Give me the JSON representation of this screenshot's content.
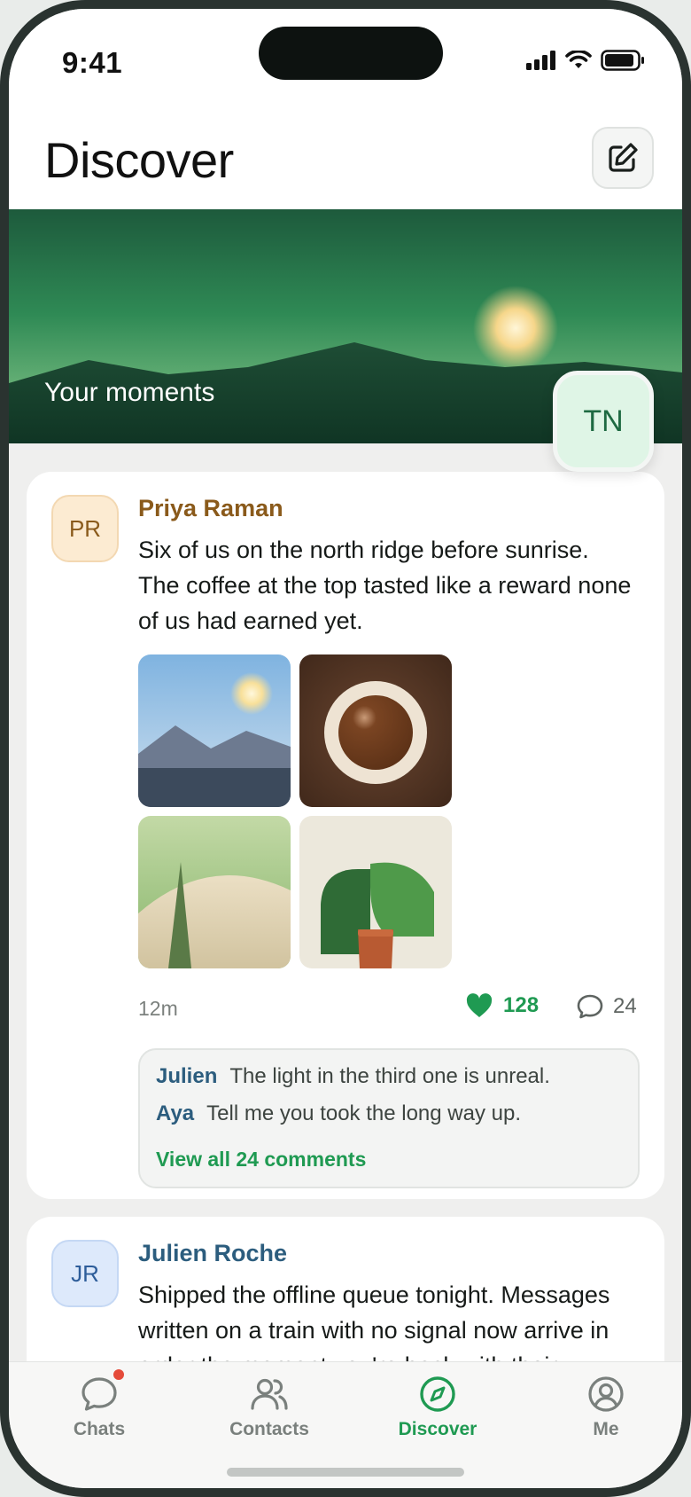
{
  "status_bar": {
    "time": "9:41"
  },
  "header": {
    "title": "Discover",
    "compose_icon": "compose-icon"
  },
  "hero": {
    "label": "Your moments",
    "user_initials": "TN"
  },
  "posts": [
    {
      "initials": "PR",
      "author": "Priya Raman",
      "text": "Six of us on the north ridge before sunrise. The coffee at the top tasted like a reward none of us had earned yet.",
      "time": "12m",
      "likes": "128",
      "comments_count": "24",
      "comments": [
        {
          "author": "Julien",
          "text": "The light in the third one is unreal."
        },
        {
          "author": "Aya",
          "text": "Tell me you took the long way up."
        }
      ],
      "view_all": "View all 24 comments"
    },
    {
      "initials": "JR",
      "author": "Julien Roche",
      "text": "Shipped the offline queue tonight. Messages written on a train with no signal now arrive in order the moment you're back with their"
    }
  ],
  "tabs": [
    {
      "label": "Chats",
      "icon": "chat-bubble-icon",
      "badge": true
    },
    {
      "label": "Contacts",
      "icon": "people-icon"
    },
    {
      "label": "Discover",
      "icon": "compass-icon",
      "active": true
    },
    {
      "label": "Me",
      "icon": "person-circle-icon"
    }
  ],
  "colors": {
    "accent": "#1f9a52",
    "badge": "#e54b3a"
  }
}
